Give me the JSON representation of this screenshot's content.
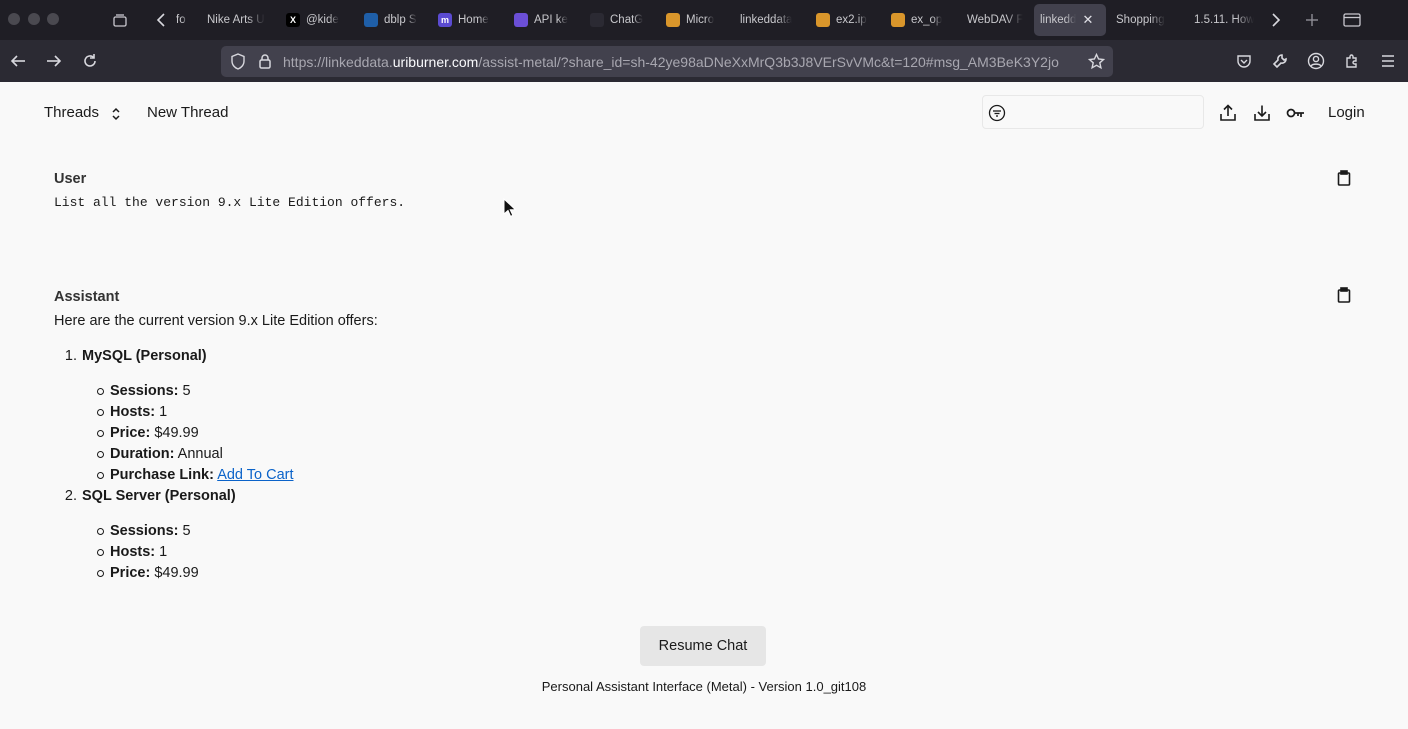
{
  "browser": {
    "tabs": [
      {
        "label": "fo",
        "favicon": "",
        "color": "#1f1e25"
      },
      {
        "label": "Nike Arts U",
        "favicon": "",
        "color": "#1f1e25"
      },
      {
        "label": "@kide",
        "favicon": "X",
        "color": "#000000"
      },
      {
        "label": "dblp S",
        "favicon": "",
        "color": "#1f5fa8"
      },
      {
        "label": "Home",
        "favicon": "m",
        "color": "#5b4bd1"
      },
      {
        "label": "API ke",
        "favicon": "",
        "color": "#6b4fd6"
      },
      {
        "label": "ChatG",
        "favicon": "",
        "color": "#2b2a33"
      },
      {
        "label": "Micro",
        "favicon": "",
        "color": "#d9962b"
      },
      {
        "label": "linkeddata",
        "favicon": "",
        "color": "#1f1e25"
      },
      {
        "label": "ex2.ip",
        "favicon": "",
        "color": "#d9962b"
      },
      {
        "label": "ex_op",
        "favicon": "",
        "color": "#d9962b"
      },
      {
        "label": "WebDAV F",
        "favicon": "",
        "color": "#1f1e25"
      },
      {
        "label": "linkedd",
        "favicon": "",
        "color": "#1f1e25",
        "active": true
      },
      {
        "label": "Shopping",
        "favicon": "",
        "color": "#1f1e25"
      },
      {
        "label": "1.5.11. How",
        "favicon": "",
        "color": "#1f1e25"
      }
    ],
    "url_prefix": "https://linkeddata.",
    "url_host": "uriburner.com",
    "url_path": "/assist-metal/?share_id=sh-42ye98aDNeXxMrQ3b3J8VErSvVMc&t=120#msg_AM3BeK3Y2jo"
  },
  "header": {
    "threads_label": "Threads",
    "new_thread_label": "New Thread",
    "search_placeholder": "",
    "login_label": "Login"
  },
  "messages": {
    "user_role": "User",
    "user_text": "List all the version 9.x Lite Edition offers.",
    "assistant_role": "Assistant",
    "assistant_intro": "Here are the current version 9.x Lite Edition offers:",
    "products": [
      {
        "number": "1.",
        "title": "MySQL (Personal)",
        "attrs": [
          {
            "key": "Sessions:",
            "value": " 5"
          },
          {
            "key": "Hosts:",
            "value": " 1"
          },
          {
            "key": "Price:",
            "value": " $49.99"
          },
          {
            "key": "Duration:",
            "value": " Annual"
          },
          {
            "key": "Purchase Link:",
            "value": "",
            "link": "Add To Cart"
          }
        ]
      },
      {
        "number": "2.",
        "title": "SQL Server (Personal)",
        "attrs": [
          {
            "key": "Sessions:",
            "value": " 5"
          },
          {
            "key": "Hosts:",
            "value": " 1"
          },
          {
            "key": "Price:",
            "value": " $49.99"
          }
        ]
      }
    ]
  },
  "resume_label": "Resume Chat",
  "footer_text": "Personal Assistant Interface (Metal) - Version 1.0_git108",
  "colors": {
    "link": "#0b63c9",
    "chrome_dark": "#1f1e25",
    "urlbar": "#42414d"
  }
}
